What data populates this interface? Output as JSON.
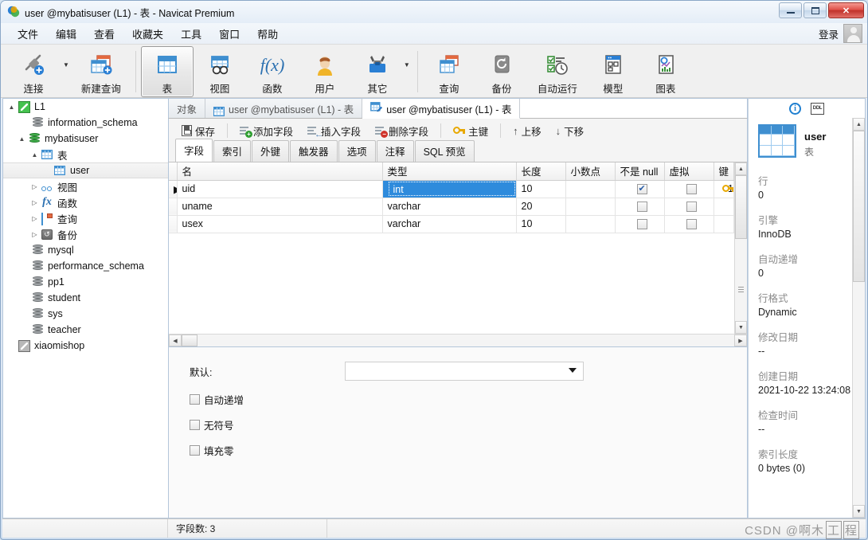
{
  "window": {
    "title": "user @mybatisuser (L1) - 表 - Navicat Premium",
    "minimize_label": "最小化",
    "maximize_label": "最大化",
    "close_label": "✕"
  },
  "menubar": {
    "items": [
      "文件",
      "编辑",
      "查看",
      "收藏夹",
      "工具",
      "窗口",
      "帮助"
    ],
    "login_label": "登录"
  },
  "ribbon": {
    "buttons": [
      {
        "label": "连接",
        "icon": "connection-icon",
        "caret": true
      },
      {
        "label": "新建查询",
        "icon": "new-query-icon",
        "caret": false
      },
      {
        "label": "表",
        "icon": "table-icon",
        "active": true
      },
      {
        "label": "视图",
        "icon": "view-icon"
      },
      {
        "label": "函数",
        "icon": "function-icon"
      },
      {
        "label": "用户",
        "icon": "user-icon"
      },
      {
        "label": "其它",
        "icon": "other-tools-icon",
        "caret": true
      },
      {
        "label": "查询",
        "icon": "query-icon"
      },
      {
        "label": "备份",
        "icon": "backup-icon"
      },
      {
        "label": "自动运行",
        "icon": "automation-icon"
      },
      {
        "label": "模型",
        "icon": "model-icon"
      },
      {
        "label": "图表",
        "icon": "chart-icon"
      }
    ]
  },
  "tree": {
    "nodes": [
      {
        "label": "L1",
        "icon": "connection-green-icon",
        "indent": 0,
        "expander": "▲",
        "selected": false
      },
      {
        "label": "information_schema",
        "icon": "database-icon",
        "indent": 1,
        "expander": "",
        "selected": false
      },
      {
        "label": "mybatisuser",
        "icon": "database-green-icon",
        "indent": 1,
        "expander": "▲",
        "selected": false
      },
      {
        "label": "表",
        "icon": "table-grid-icon",
        "indent": 2,
        "expander": "▲",
        "selected": false
      },
      {
        "label": "user",
        "icon": "table-grid-icon",
        "indent": 3,
        "expander": "",
        "selected": true
      },
      {
        "label": "视图",
        "icon": "view-icon",
        "indent": 2,
        "expander": "▷",
        "selected": false
      },
      {
        "label": "函数",
        "icon": "function-icon",
        "indent": 2,
        "expander": "▷",
        "selected": false
      },
      {
        "label": "查询",
        "icon": "query-icon",
        "indent": 2,
        "expander": "▷",
        "selected": false
      },
      {
        "label": "备份",
        "icon": "backup-icon",
        "indent": 2,
        "expander": "▷",
        "selected": false
      },
      {
        "label": "mysql",
        "icon": "database-icon",
        "indent": 1,
        "expander": "",
        "selected": false
      },
      {
        "label": "performance_schema",
        "icon": "database-icon",
        "indent": 1,
        "expander": "",
        "selected": false
      },
      {
        "label": "pp1",
        "icon": "database-icon",
        "indent": 1,
        "expander": "",
        "selected": false
      },
      {
        "label": "student",
        "icon": "database-icon",
        "indent": 1,
        "expander": "",
        "selected": false
      },
      {
        "label": "sys",
        "icon": "database-icon",
        "indent": 1,
        "expander": "",
        "selected": false
      },
      {
        "label": "teacher",
        "icon": "database-icon",
        "indent": 1,
        "expander": "",
        "selected": false
      },
      {
        "label": "xiaomishop",
        "icon": "connection-gray-icon",
        "indent": 0,
        "expander": "",
        "selected": false
      }
    ]
  },
  "doctabs": {
    "objects_label": "对象",
    "tabs": [
      {
        "label": "user @mybatisuser (L1) - 表",
        "icon": "table-grid-icon",
        "active": false
      },
      {
        "label": "user @mybatisuser (L1) - 表",
        "icon": "table-design-icon",
        "active": true
      }
    ]
  },
  "edit_toolbar": {
    "items": [
      {
        "label": "保存",
        "icon": "save-icon"
      },
      {
        "label": "添加字段",
        "icon": "add-field-icon"
      },
      {
        "label": "插入字段",
        "icon": "insert-field-icon"
      },
      {
        "label": "删除字段",
        "icon": "delete-field-icon"
      },
      {
        "label": "主键",
        "icon": "primary-key-icon"
      },
      {
        "label": "上移",
        "icon": "move-up-icon"
      },
      {
        "label": "下移",
        "icon": "move-down-icon"
      }
    ]
  },
  "inner_tabs": [
    {
      "label": "字段",
      "active": true
    },
    {
      "label": "索引",
      "active": false
    },
    {
      "label": "外键",
      "active": false
    },
    {
      "label": "触发器",
      "active": false
    },
    {
      "label": "选项",
      "active": false
    },
    {
      "label": "注释",
      "active": false
    },
    {
      "label": "SQL 预览",
      "active": false
    }
  ],
  "grid": {
    "columns": [
      "名",
      "类型",
      "长度",
      "小数点",
      "不是 null",
      "虚拟",
      "键"
    ],
    "rows": [
      {
        "marker": "▶",
        "name": "uid",
        "type": "int",
        "type_selected": true,
        "length": "10",
        "decimals": "",
        "not_null": true,
        "virtual": false,
        "key": "1",
        "has_key": true
      },
      {
        "marker": "",
        "name": "uname",
        "type": "varchar",
        "type_selected": false,
        "length": "20",
        "decimals": "",
        "not_null": false,
        "virtual": false,
        "key": "",
        "has_key": false
      },
      {
        "marker": "",
        "name": "usex",
        "type": "varchar",
        "type_selected": false,
        "length": "10",
        "decimals": "",
        "not_null": false,
        "virtual": false,
        "key": "",
        "has_key": false
      }
    ]
  },
  "form": {
    "default_label": "默认:",
    "default_value": "",
    "checkboxes": [
      {
        "label": "自动递增",
        "checked": false
      },
      {
        "label": "无符号",
        "checked": false
      },
      {
        "label": "填充零",
        "checked": false
      }
    ]
  },
  "info_panel": {
    "info_icon": "i",
    "ddl_icon": "DDL",
    "object_name": "user",
    "object_type": "表",
    "properties": [
      {
        "key": "行",
        "value": "0"
      },
      {
        "key": "引擎",
        "value": "InnoDB"
      },
      {
        "key": "自动递增",
        "value": "0"
      },
      {
        "key": "行格式",
        "value": "Dynamic"
      },
      {
        "key": "修改日期",
        "value": "--"
      },
      {
        "key": "创建日期",
        "value": "2021-10-22 13:24:08"
      },
      {
        "key": "检查时间",
        "value": "--"
      },
      {
        "key": "索引长度",
        "value": "0 bytes (0)"
      }
    ]
  },
  "statusbar": {
    "left": "",
    "field_count": "字段数: 3",
    "right": "",
    "watermark_prefix": "CSDN @啊木",
    "watermark_boxed1": "工",
    "watermark_boxed2": "程"
  },
  "colors": {
    "accent_blue": "#3f8fd0",
    "selection_blue": "#2e8bdc",
    "key_gold": "#e8a800",
    "green": "#3fae49",
    "close_red": "#c0322b"
  }
}
